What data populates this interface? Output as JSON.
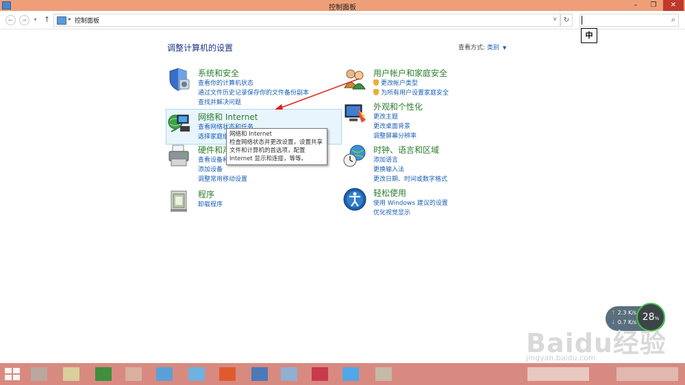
{
  "window": {
    "title": "控制面板",
    "min": "–",
    "max": "❐",
    "close": "✕"
  },
  "address": {
    "back": "←",
    "forward": "→",
    "up": "↑",
    "separator": "▸",
    "breadcrumb": "控制面板",
    "dropdown": "∨",
    "refresh": "↻",
    "search_icon": "⚲"
  },
  "ime": "中",
  "main": {
    "title": "调整计算机的设置",
    "viewby_label": "查看方式:",
    "viewby_value": "类别",
    "viewby_arrow": "▼"
  },
  "categories": [
    {
      "id": "system",
      "title": "系统和安全",
      "icon": "shield-icon",
      "links": [
        "查看你的计算机状态",
        "通过文件历史记录保存你的文件备份副本",
        "查找并解决问题"
      ]
    },
    {
      "id": "network",
      "title": "网络和 Internet",
      "icon": "network-globe-icon",
      "links": [
        "查看网络状态和任务",
        "选择家庭组和共享选项"
      ]
    },
    {
      "id": "hardware",
      "title": "硬件和声音",
      "icon": "printer-icon",
      "links": [
        "查看设备和打印机",
        "添加设备",
        "调整常用移动设置"
      ]
    },
    {
      "id": "programs",
      "title": "程序",
      "icon": "programs-icon",
      "links": [
        "卸载程序"
      ]
    },
    {
      "id": "users",
      "title": "用户帐户和家庭安全",
      "icon": "users-icon",
      "links": [
        "更改帐户类型",
        "为所有用户设置家庭安全"
      ]
    },
    {
      "id": "appearance",
      "title": "外观和个性化",
      "icon": "appearance-icon",
      "links": [
        "更改主题",
        "更改桌面背景",
        "调整屏幕分辨率"
      ]
    },
    {
      "id": "clock",
      "title": "时钟、语言和区域",
      "icon": "clock-globe-icon",
      "links": [
        "添加语言",
        "更换输入法",
        "更改日期、时间或数字格式"
      ]
    },
    {
      "id": "ease",
      "title": "轻松使用",
      "icon": "ease-of-access-icon",
      "links": [
        "使用 Windows 建议的设置",
        "优化视觉显示"
      ]
    }
  ],
  "tooltip": {
    "lines": [
      "网络和 Internet",
      "检查网络状态并更改设置，设置共享",
      "文件和计算机的首选项，配置",
      "Internet 显示和连接，等等。"
    ]
  },
  "netmeter": {
    "up": "2.3",
    "down": "0.7",
    "unit": "K/s",
    "percent": "28",
    "percent_unit": "%"
  },
  "watermark": {
    "line1": "Baidu经验",
    "line2": "jingyan.baidu.com"
  },
  "colors": {
    "titlebar": "#ef9f78",
    "category_title": "#2a7d2a",
    "link": "#1a5fb4",
    "annotation_arrow": "#e02020"
  }
}
